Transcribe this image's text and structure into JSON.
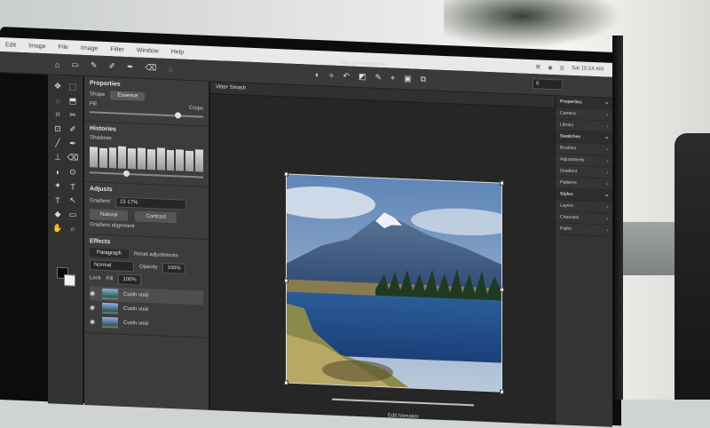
{
  "menu": [
    "Edit",
    "Image",
    "File",
    "Image",
    "Filter",
    "Window",
    "Help"
  ],
  "menu_right": [
    "⌘",
    "◉",
    "☰",
    "Sat 10:24 AM"
  ],
  "toolbar": {
    "icons": [
      "home-icon",
      "folder-icon",
      "eyedropper-icon",
      "brush-icon",
      "pen-icon",
      "eraser-icon",
      "lasso-icon"
    ],
    "doc_title": "Fay 1h4-edgeborac",
    "center_icons": [
      "◐",
      "⟡",
      "↶",
      "◩",
      "✎",
      "⌖",
      "▣",
      "⧉"
    ],
    "zoom_value": "6"
  },
  "tools": [
    "✥",
    "⬚",
    "◌",
    "⬒",
    "⌗",
    "✂",
    "⊡",
    "✐",
    "╱",
    "✒",
    "⊥",
    "⌫",
    "◗",
    "⊙",
    "✦",
    "T",
    "T",
    "↖",
    "◆",
    "▭",
    "✋",
    "⌕"
  ],
  "properties": {
    "title": "Properties",
    "row1": {
      "label": "Shape",
      "active": "Essence"
    },
    "row2": {
      "left": "Fill",
      "right": "Crops"
    },
    "histogram_title": "Histories",
    "histogram_sub": "Shadows",
    "histogram_bars": [
      0.9,
      0.85,
      0.9,
      0.95,
      0.9,
      0.92,
      0.88,
      0.95,
      0.9,
      0.93,
      0.9,
      0.95
    ],
    "adjust_title": "Adjusts",
    "adjust_label": "Gradient",
    "adjust_select": "15 17% ",
    "btn_a": "Natural",
    "btn_b": "Contrast",
    "adjust_note": "Gradient alignment",
    "effects_title": "Effects",
    "effects_tab_a": "Paragraph",
    "effects_tab_b": "Reset adjustments",
    "blend_mode": "Normal",
    "opacity_label": "Opacity",
    "opacity_value": "100%",
    "fill_label": "Fill",
    "fill_value": "100%",
    "lock_label": "Lock",
    "layers": [
      "Cusln void",
      "Cusln void",
      "Cusln void"
    ]
  },
  "canvas": {
    "tab": "Vitter Smash",
    "status": "Edit hitmaker"
  },
  "right_panel": {
    "items": [
      "Properties",
      "Camera",
      "Library",
      "Swatches",
      "Brushes",
      "Adjustments",
      "Gradient",
      "Patterns",
      "Styles",
      "Layers",
      "Channels",
      "Paths"
    ]
  }
}
